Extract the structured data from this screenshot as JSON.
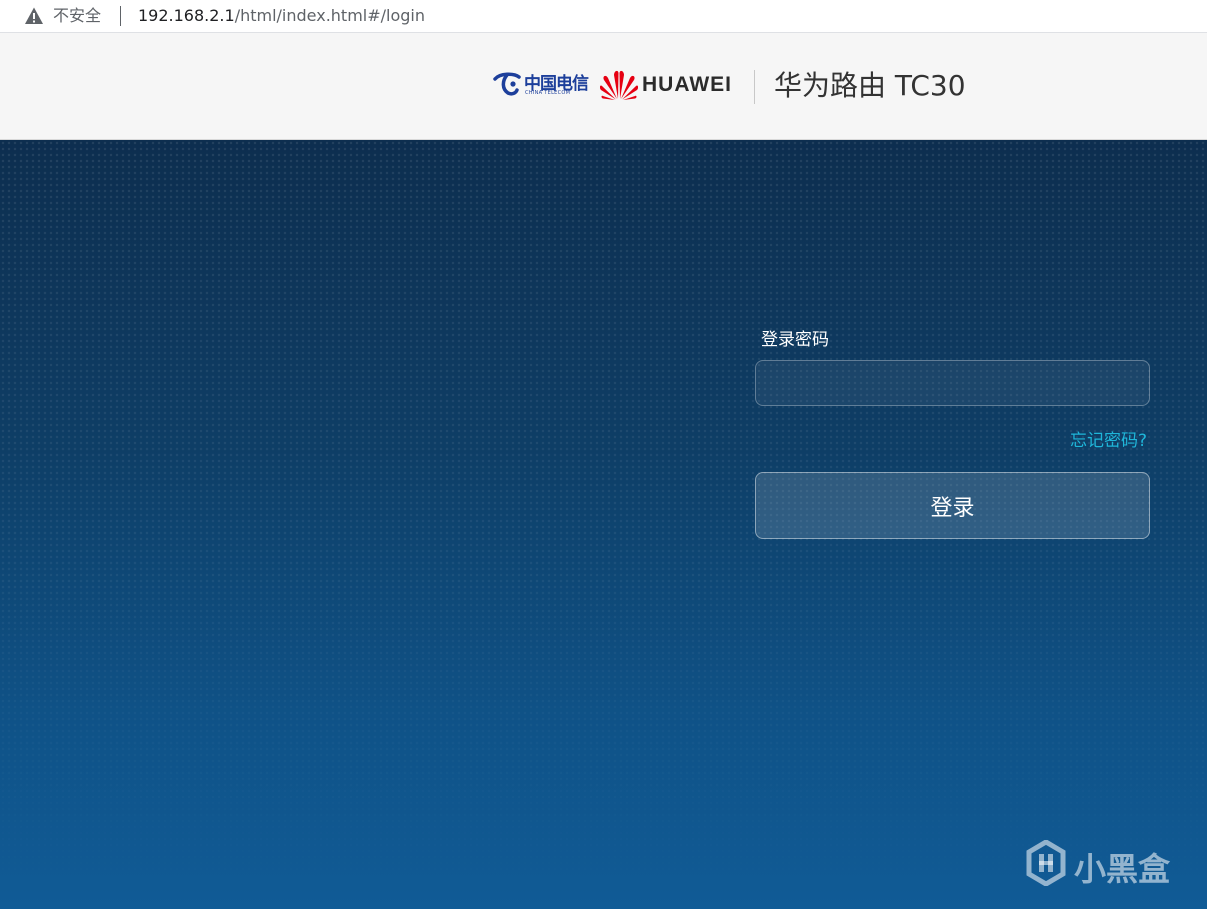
{
  "browser": {
    "security_label": "不安全",
    "url_host": "192.168.2.1",
    "url_path": "/html/index.html#/login"
  },
  "header": {
    "carrier_logo_cn": "中国电信",
    "carrier_logo_en": "CHINA TELECOM",
    "brand": "HUAWEI",
    "product_title": "华为路由 TC30"
  },
  "login": {
    "password_label": "登录密码",
    "password_value": "",
    "forgot_password": "忘记密码?",
    "login_button": "登录"
  },
  "watermark": {
    "text": "小黑盒"
  },
  "colors": {
    "link": "#1fb6d9",
    "huawei_red": "#e60012",
    "telecom_blue": "#1d3f9b",
    "background_top": "#0d2e4f",
    "background_bottom": "#105b96"
  },
  "icons": [
    "warning-icon",
    "china-telecom-logo-icon",
    "huawei-flower-icon",
    "xiaoheihe-watermark-icon"
  ]
}
